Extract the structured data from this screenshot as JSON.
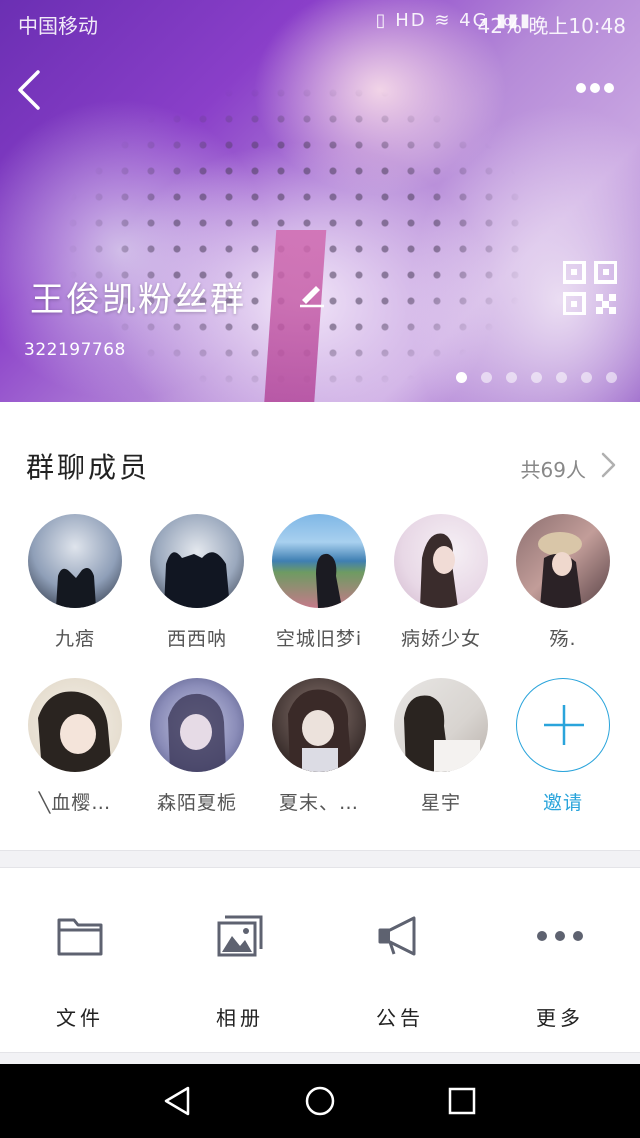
{
  "status_bar": {
    "carrier": "中国移动",
    "icons": "▯ HD ≋ 4G ▮▮▮",
    "battery": "42%",
    "time": "晚上10:48"
  },
  "header": {
    "group_name": "王俊凯粉丝群",
    "group_id": "322197768",
    "page_dots": 7,
    "active_dot": 0
  },
  "members": {
    "title": "群聊成员",
    "count": "共69人",
    "items": [
      {
        "name": "九痞"
      },
      {
        "name": "西西呐"
      },
      {
        "name": "空城旧梦i"
      },
      {
        "name": "病娇少女"
      },
      {
        "name": "殇."
      },
      {
        "name": "╲血樱…"
      },
      {
        "name": "森陌夏栀"
      },
      {
        "name": "夏末、…"
      },
      {
        "name": "星宇"
      }
    ],
    "invite_label": "邀请"
  },
  "tools": {
    "file": "文件",
    "album": "相册",
    "notice": "公告",
    "more": "更多"
  },
  "colors": {
    "accent": "#2aa4db",
    "icon_gray": "#5e6270"
  }
}
